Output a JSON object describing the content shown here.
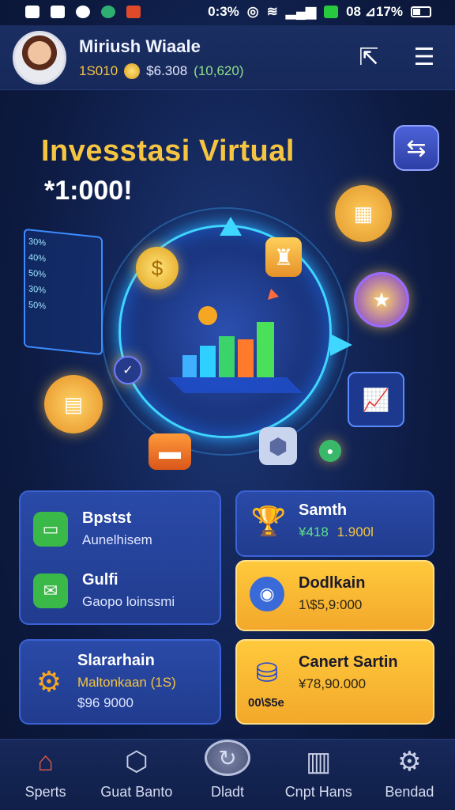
{
  "status_bar": {
    "time": "0:3%",
    "battery_text": "08 ⊿17%"
  },
  "header": {
    "username": "Miriush Wiaale",
    "stat_a": "1S010",
    "stat_b": "$6.308",
    "stat_c": "(10,620)"
  },
  "hero": {
    "title": "Invesstasi Virtual",
    "amount": "*1:000!",
    "panel_lines": [
      "30%",
      "40%",
      "50%",
      "30%",
      "50%"
    ]
  },
  "cards": {
    "left_top": [
      {
        "title": "Bpstst",
        "subtitle": "Aunelhisem"
      },
      {
        "title": "Gulfi",
        "subtitle": "Gaopo loinssmi"
      }
    ],
    "left_bottom": {
      "title": "Slararhain",
      "subtitle": "Maltonkaan (1S)",
      "value": "$96 9000"
    },
    "right_top": {
      "title": "Samth",
      "value_a": "¥418",
      "value_b": "1.900l"
    },
    "right_mid": {
      "title": "Dodlkain",
      "subtitle": "1\\$5,9:000"
    },
    "right_bottom": {
      "title": "Canert Sartin",
      "subtitle": "¥78,90.000",
      "badge": "00\\$5e"
    }
  },
  "nav": [
    {
      "label": "Sperts",
      "icon": "home-icon"
    },
    {
      "label": "Guat Banto",
      "icon": "shield-icon"
    },
    {
      "label": "Dladt",
      "icon": "refresh-icon"
    },
    {
      "label": "Cnpt Hans",
      "icon": "chart-icon"
    },
    {
      "label": "Bendad",
      "icon": "gear-icon"
    }
  ],
  "colors": {
    "accent_gold": "#f5c542",
    "card_blue": "#2a4aa8",
    "card_gold": "#ffc93c",
    "ring_cyan": "#3fd6ff"
  }
}
